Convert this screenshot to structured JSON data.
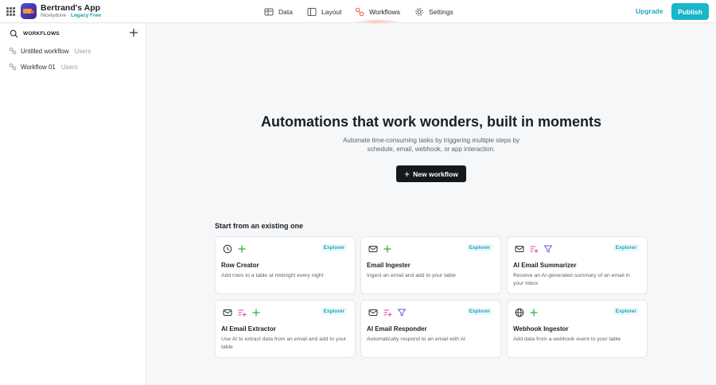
{
  "app": {
    "name": "Bertrand's App",
    "workspace": "Nicelydone",
    "separator": "·",
    "plan": "Legacy Free"
  },
  "nav": {
    "items": [
      {
        "label": "Data",
        "icon": "table-icon"
      },
      {
        "label": "Layout",
        "icon": "layout-icon"
      },
      {
        "label": "Workflows",
        "icon": "workflows-icon",
        "active": true
      },
      {
        "label": "Settings",
        "icon": "gear-icon"
      }
    ],
    "upgrade_label": "Upgrade",
    "publish_label": "Publish"
  },
  "sidebar": {
    "title": "WORKFLOWS",
    "items": [
      {
        "name": "Untitled workflow",
        "tag": "Users"
      },
      {
        "name": "Workflow 01",
        "tag": "Users"
      }
    ]
  },
  "hero": {
    "title": "Automations that work wonders, built in moments",
    "subtitle": "Automate time-consuming tasks by triggering multiple steps by schedule, email, webhook, or app interaction.",
    "button_label": "New workflow"
  },
  "templates": {
    "section_title": "Start from an existing one",
    "cards": [
      {
        "title": "Row Creator",
        "description": "Add rows to a table at midnight every night",
        "badge": "Explorer",
        "icons": [
          "clock-icon",
          "plus-icon"
        ]
      },
      {
        "title": "Email Ingester",
        "description": "Ingest an email and add to your table",
        "badge": "Explorer",
        "icons": [
          "mail-icon",
          "plus-icon"
        ]
      },
      {
        "title": "AI Email Summarizer",
        "description": "Receive an AI-generated summary of an email in your inbox",
        "badge": "Explorer",
        "icons": [
          "mail-icon",
          "ai-list-icon",
          "filter-icon"
        ]
      },
      {
        "title": "AI Email Extractor",
        "description": "Use AI to extract data from an email and add to your table",
        "badge": "Explorer",
        "icons": [
          "mail-icon",
          "ai-list-icon",
          "plus-icon"
        ]
      },
      {
        "title": "AI Email Responder",
        "description": "Automatically respond to an email with AI",
        "badge": "Explorer",
        "icons": [
          "mail-icon",
          "ai-list-icon",
          "filter-icon"
        ]
      },
      {
        "title": "Webhook Ingestor",
        "description": "Add data from a webhook event to your table",
        "badge": "Explorer",
        "icons": [
          "globe-icon",
          "plus-icon"
        ]
      }
    ]
  },
  "colors": {
    "accent": "#19b6c9",
    "accent_text": "#1ba6bf",
    "dark_button": "#16191c",
    "workflows_icon": "#f0645a",
    "plus_icon": "#2fb34a",
    "ai_icon": "#e0429b",
    "filter_icon": "#6b57e0"
  }
}
